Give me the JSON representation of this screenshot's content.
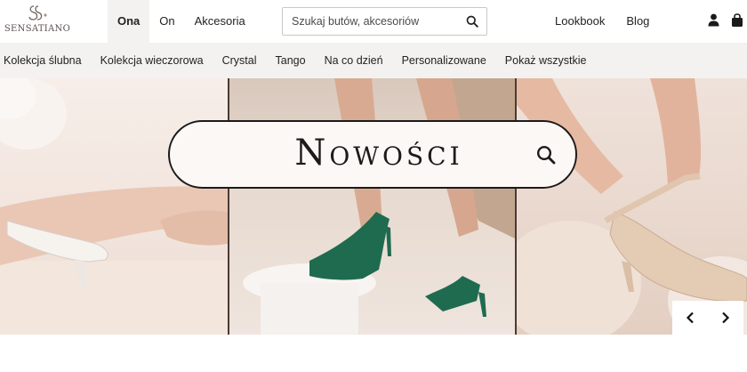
{
  "brand": {
    "name": "SENSATIANO"
  },
  "main_nav": {
    "items": [
      {
        "label": "Ona",
        "active": true
      },
      {
        "label": "On",
        "active": false
      },
      {
        "label": "Akcesoria",
        "active": false
      }
    ]
  },
  "search": {
    "placeholder": "Szukaj butów, akcesoriów"
  },
  "right_nav": {
    "lookbook": "Lookbook",
    "blog": "Blog"
  },
  "icons": {
    "search": "search-icon",
    "user": "user-icon",
    "bag": "shopping-bag-icon",
    "prev": "chevron-left-icon",
    "next": "chevron-right-icon"
  },
  "subnav": {
    "items": [
      "Kolekcja ślubna",
      "Kolekcja wieczorowa",
      "Crystal",
      "Tango",
      "Na co dzień",
      "Personalizowane",
      "Pokaż wszystkie"
    ]
  },
  "hero": {
    "title": "Nowości",
    "panels": [
      "white-bridal-pump",
      "green-t-strap-sandal",
      "champagne-strappy-sandal"
    ]
  },
  "colors": {
    "subnav_bg": "#f3f2f0",
    "text": "#1a1a1a",
    "green_shoe": "#1f6b4f",
    "champagne_shoe": "#e3cbb4"
  }
}
